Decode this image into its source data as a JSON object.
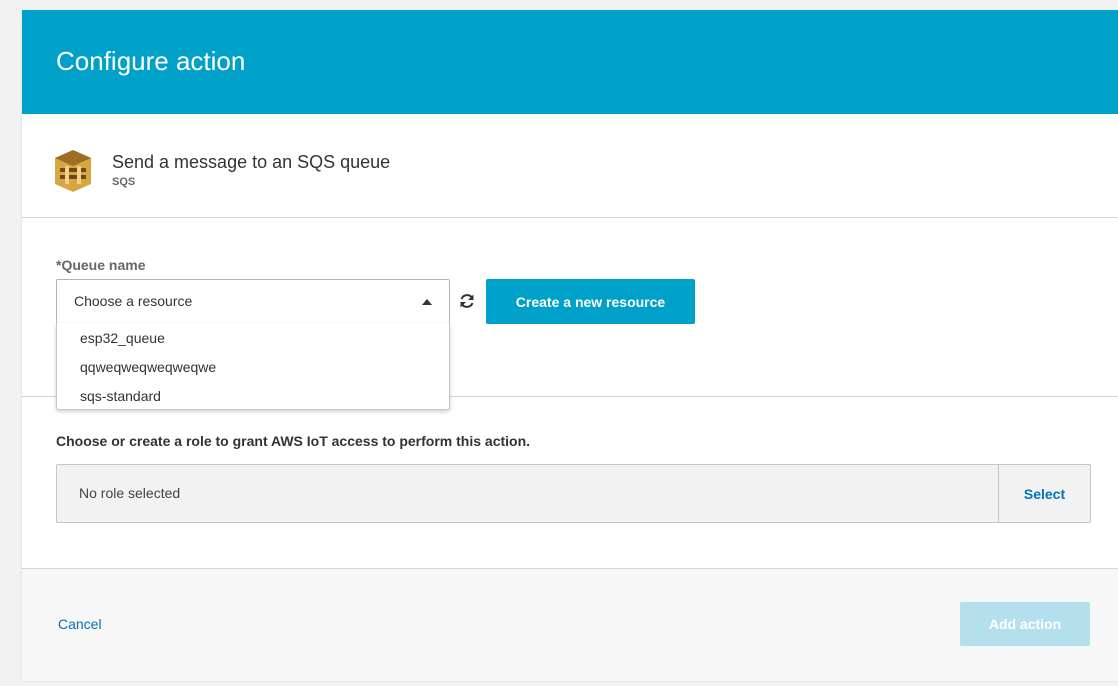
{
  "header": {
    "title": "Configure action"
  },
  "service": {
    "title": "Send a message to an SQS queue",
    "subtitle": "SQS",
    "icon": "sqs-queue-icon"
  },
  "queue": {
    "label": "*Queue name",
    "selected": "Choose a resource",
    "options": [
      "esp32_queue",
      "qqweqweqweqweqwe",
      "sqs-standard"
    ],
    "create_button": "Create a new resource"
  },
  "role": {
    "label": "Choose or create a role to grant AWS IoT access to perform this action.",
    "value": "No role selected",
    "select_label": "Select"
  },
  "footer": {
    "cancel_label": "Cancel",
    "add_label": "Add action"
  },
  "colors": {
    "accent": "#00a1c9",
    "link": "#0073bb",
    "disabled_button": "#b3e0ec"
  }
}
